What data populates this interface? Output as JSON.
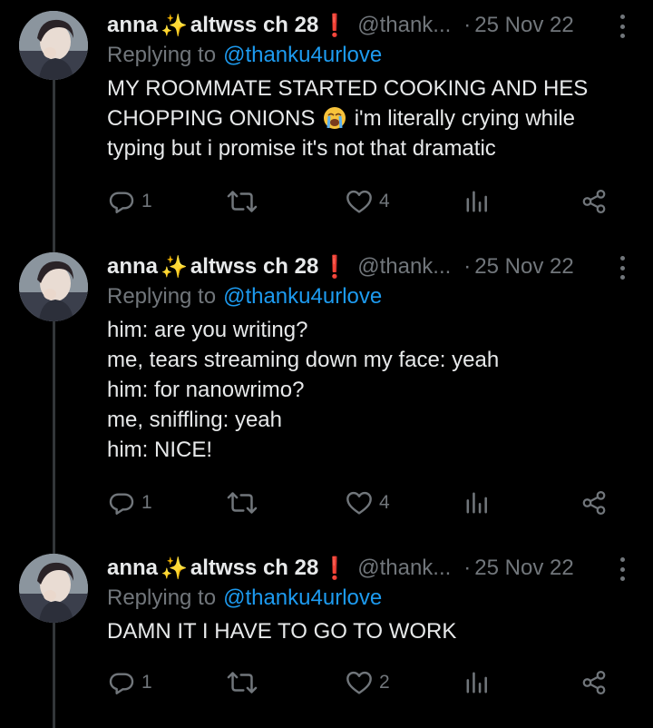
{
  "colors": {
    "background": "#000000",
    "text": "#e7e9ea",
    "muted": "#71767b",
    "mention": "#1d9bf0",
    "thread_line": "#333639"
  },
  "tweets": [
    {
      "display_name": "anna",
      "sparkle": "✨",
      "display_name_suffix": "altwss ch 28",
      "red_mark": "❗",
      "handle": "@thank...",
      "separator": "·",
      "date": "25 Nov 22",
      "replying_label": "Replying to",
      "replying_to": "@thanku4urlove",
      "text_before_emoji": "MY ROOMMATE STARTED COOKING AND HES\nCHOPPING ONIONS ",
      "emoji_icon": "loudly-crying-face-icon",
      "text_after_emoji": " i'm literally crying while\ntyping but i promise it's not that dramatic",
      "replies": "1",
      "retweets": "",
      "likes": "4"
    },
    {
      "display_name": "anna",
      "sparkle": "✨",
      "display_name_suffix": "altwss ch 28",
      "red_mark": "❗",
      "handle": "@thank...",
      "separator": "·",
      "date": "25 Nov 22",
      "replying_label": "Replying to",
      "replying_to": "@thanku4urlove",
      "text": "him: are you writing?\nme, tears streaming down my face: yeah\nhim: for nanowrimo?\nme, sniffling: yeah\nhim: NICE!",
      "replies": "1",
      "retweets": "",
      "likes": "4"
    },
    {
      "display_name": "anna",
      "sparkle": "✨",
      "display_name_suffix": "altwss ch 28",
      "red_mark": "❗",
      "handle": "@thank...",
      "separator": "·",
      "date": "25 Nov 22",
      "replying_label": "Replying to",
      "replying_to": "@thanku4urlove",
      "text": "DAMN IT I HAVE TO GO TO WORK",
      "replies": "1",
      "retweets": "",
      "likes": "2"
    }
  ]
}
